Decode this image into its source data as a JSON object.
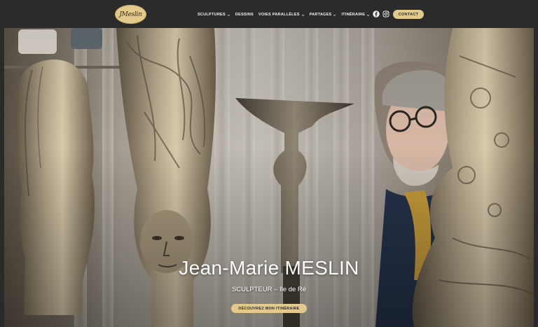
{
  "header": {
    "logo_text": "JMeslin",
    "nav": [
      {
        "label": "SCULPTURES",
        "has_dropdown": true
      },
      {
        "label": "DESSINS",
        "has_dropdown": false
      },
      {
        "label": "VOIES PARALLÈLES",
        "has_dropdown": true
      },
      {
        "label": "PARTAGES",
        "has_dropdown": true
      },
      {
        "label": "ITINÉRAIRE",
        "has_dropdown": true
      }
    ],
    "social": [
      "facebook-icon",
      "instagram-icon"
    ],
    "contact_label": "CONTACT"
  },
  "hero": {
    "title": "Jean-Marie MESLIN",
    "subtitle": "SCULPTEUR – Ile de Ré",
    "cta_label": "DÉCOUVREZ MON ITINÉRAIRE"
  },
  "colors": {
    "header_bg": "#2b2b2b",
    "accent": "#e3c98b"
  }
}
